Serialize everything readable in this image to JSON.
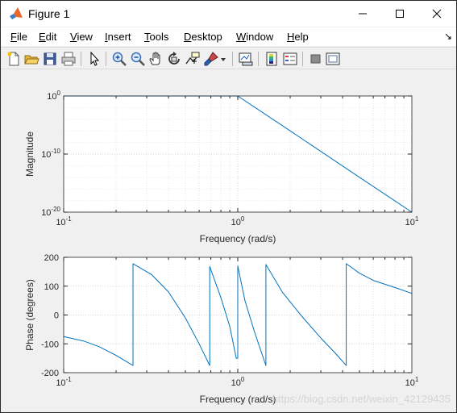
{
  "window": {
    "title": "Figure 1"
  },
  "menu": {
    "items": [
      {
        "first": "F",
        "rest": "ile"
      },
      {
        "first": "E",
        "rest": "dit"
      },
      {
        "first": "V",
        "rest": "iew"
      },
      {
        "first": "I",
        "rest": "nsert"
      },
      {
        "first": "T",
        "rest": "ools"
      },
      {
        "first": "D",
        "rest": "esktop"
      },
      {
        "first": "W",
        "rest": "indow"
      },
      {
        "first": "H",
        "rest": "elp"
      }
    ],
    "overflow_arrow": "↘"
  },
  "toolbar": {
    "buttons": [
      "new-figure-icon",
      "open-file-icon",
      "save-icon",
      "print-icon",
      "pointer-icon",
      "zoom-in-icon",
      "zoom-out-icon",
      "pan-hand-icon",
      "rotate-3d-icon",
      "data-cursor-icon",
      "brush-icon",
      "brush-dropdown-icon",
      "link-plot-icon",
      "colorbar-icon",
      "legend-icon",
      "hide-plot-tools-icon",
      "show-plot-tools-icon"
    ]
  },
  "watermark": "https://blog.csdn.net/weixin_42129435",
  "chart_data": [
    {
      "type": "line",
      "title": "",
      "xlabel": "Frequency (rad/s)",
      "ylabel": "Magnitude",
      "xscale": "log",
      "yscale": "log",
      "xlim": [
        0.1,
        10
      ],
      "ylim": [
        1e-20,
        1
      ],
      "grid": true,
      "x_tick_labels": [
        {
          "base": "10",
          "exp": "-1"
        },
        {
          "base": "10",
          "exp": "0"
        },
        {
          "base": "10",
          "exp": "1"
        }
      ],
      "y_tick_labels": [
        {
          "base": "10",
          "exp": "0"
        },
        {
          "base": "10",
          "exp": "-10"
        },
        {
          "base": "10",
          "exp": "-20"
        }
      ],
      "series": [
        {
          "x": [
            0.1,
            0.5,
            0.9,
            1.0,
            2.0,
            5.0,
            10.0
          ],
          "y": [
            1,
            1,
            1,
            1,
            1e-06,
            1e-14,
            1e-20
          ]
        }
      ],
      "color": "#0072bd"
    },
    {
      "type": "line",
      "title": "",
      "xlabel": "Frequency (rad/s)",
      "ylabel": "Phase (degrees)",
      "xscale": "log",
      "xlim": [
        0.1,
        10
      ],
      "ylim": [
        -200,
        200
      ],
      "yticks": [
        200,
        100,
        0,
        -100,
        -200
      ],
      "grid": true,
      "x_tick_labels": [
        {
          "base": "10",
          "exp": "-1"
        },
        {
          "base": "10",
          "exp": "0"
        },
        {
          "base": "10",
          "exp": "1"
        }
      ],
      "series": [
        {
          "x": [
            0.1,
            0.13,
            0.16,
            0.2,
            0.25,
            0.25,
            0.32,
            0.4,
            0.5,
            0.6,
            0.69,
            0.69,
            0.8,
            0.9,
            0.98,
            1.0,
            1.0,
            1.1,
            1.25,
            1.45,
            1.45,
            1.8,
            2.3,
            3.0,
            3.6,
            4.2,
            4.2,
            5.0,
            6.0,
            8.0,
            10.0
          ],
          "y": [
            -75,
            -90,
            -110,
            -140,
            -175,
            178,
            140,
            80,
            -10,
            -100,
            -175,
            168,
            60,
            -40,
            -150,
            -150,
            170,
            50,
            -60,
            -175,
            175,
            80,
            0,
            -80,
            -130,
            -175,
            178,
            145,
            120,
            95,
            75
          ]
        }
      ],
      "color": "#0072bd"
    }
  ]
}
